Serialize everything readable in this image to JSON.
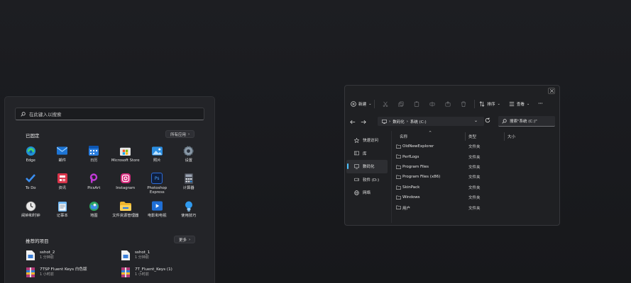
{
  "start_menu": {
    "search_placeholder": "在此键入以搜索",
    "pinned_title": "已固定",
    "all_apps_label": "所有应用",
    "pinned_apps": [
      {
        "label": "Edge",
        "icon": "edge-icon"
      },
      {
        "label": "邮件",
        "icon": "mail-icon"
      },
      {
        "label": "日历",
        "icon": "calendar-icon"
      },
      {
        "label": "Microsoft Store",
        "icon": "store-icon"
      },
      {
        "label": "照片",
        "icon": "photos-icon"
      },
      {
        "label": "设置",
        "icon": "settings-icon"
      },
      {
        "label": "To Do",
        "icon": "todo-icon"
      },
      {
        "label": "资讯",
        "icon": "news-icon"
      },
      {
        "label": "PicsArt",
        "icon": "picsart-icon"
      },
      {
        "label": "Instagram",
        "icon": "instagram-icon"
      },
      {
        "label": "Photoshop\nExpress",
        "icon": "photoshop-icon"
      },
      {
        "label": "计算器",
        "icon": "calculator-icon"
      },
      {
        "label": "闹钟和时钟",
        "icon": "clock-icon"
      },
      {
        "label": "记事本",
        "icon": "notepad-icon"
      },
      {
        "label": "地图",
        "icon": "maps-icon"
      },
      {
        "label": "文件资源管理器",
        "icon": "folder-icon"
      },
      {
        "label": "电影和电视",
        "icon": "movies-icon"
      },
      {
        "label": "使用技巧",
        "icon": "tips-icon"
      }
    ],
    "recommended_title": "推荐的项目",
    "more_label": "更多",
    "recommended": [
      {
        "name": "sshot_2",
        "time": "1 分钟前",
        "icon": "image-file-icon"
      },
      {
        "name": "sshot_1",
        "time": "1 分钟前",
        "icon": "image-file-icon"
      },
      {
        "name": "7TSP Fluent Keys 白色版",
        "time": "1 小时前",
        "icon": "archive-file-icon"
      },
      {
        "name": "7T_Fluent_Keys (1)",
        "time": "1 小时前",
        "icon": "archive-file-icon"
      }
    ]
  },
  "explorer": {
    "new_label": "新建",
    "sort_label": "排序",
    "view_label": "查看",
    "more_glyph": "···",
    "breadcrumb": [
      "数码化",
      "系统 (C:)"
    ],
    "search_placeholder": "搜索\"系统 (C:)\"",
    "nav_items": [
      {
        "label": "快速访问",
        "icon": "star-icon",
        "selected": false
      },
      {
        "label": "库",
        "icon": "library-icon",
        "selected": false
      },
      {
        "label": "数码化",
        "icon": "pc-icon",
        "selected": true
      },
      {
        "label": "软件 (D:)",
        "icon": "drive-icon",
        "selected": false
      },
      {
        "label": "网络",
        "icon": "network-icon",
        "selected": false
      }
    ],
    "columns": {
      "name": "名称",
      "type": "类型",
      "size": "大小"
    },
    "files": [
      {
        "name": "OldNewExplorer",
        "type": "文件夹"
      },
      {
        "name": "PerfLogs",
        "type": "文件夹"
      },
      {
        "name": "Program Files",
        "type": "文件夹"
      },
      {
        "name": "Program Files (x86)",
        "type": "文件夹"
      },
      {
        "name": "SkinPack",
        "type": "文件夹"
      },
      {
        "name": "Windows",
        "type": "文件夹"
      },
      {
        "name": "用户",
        "type": "文件夹"
      }
    ]
  }
}
